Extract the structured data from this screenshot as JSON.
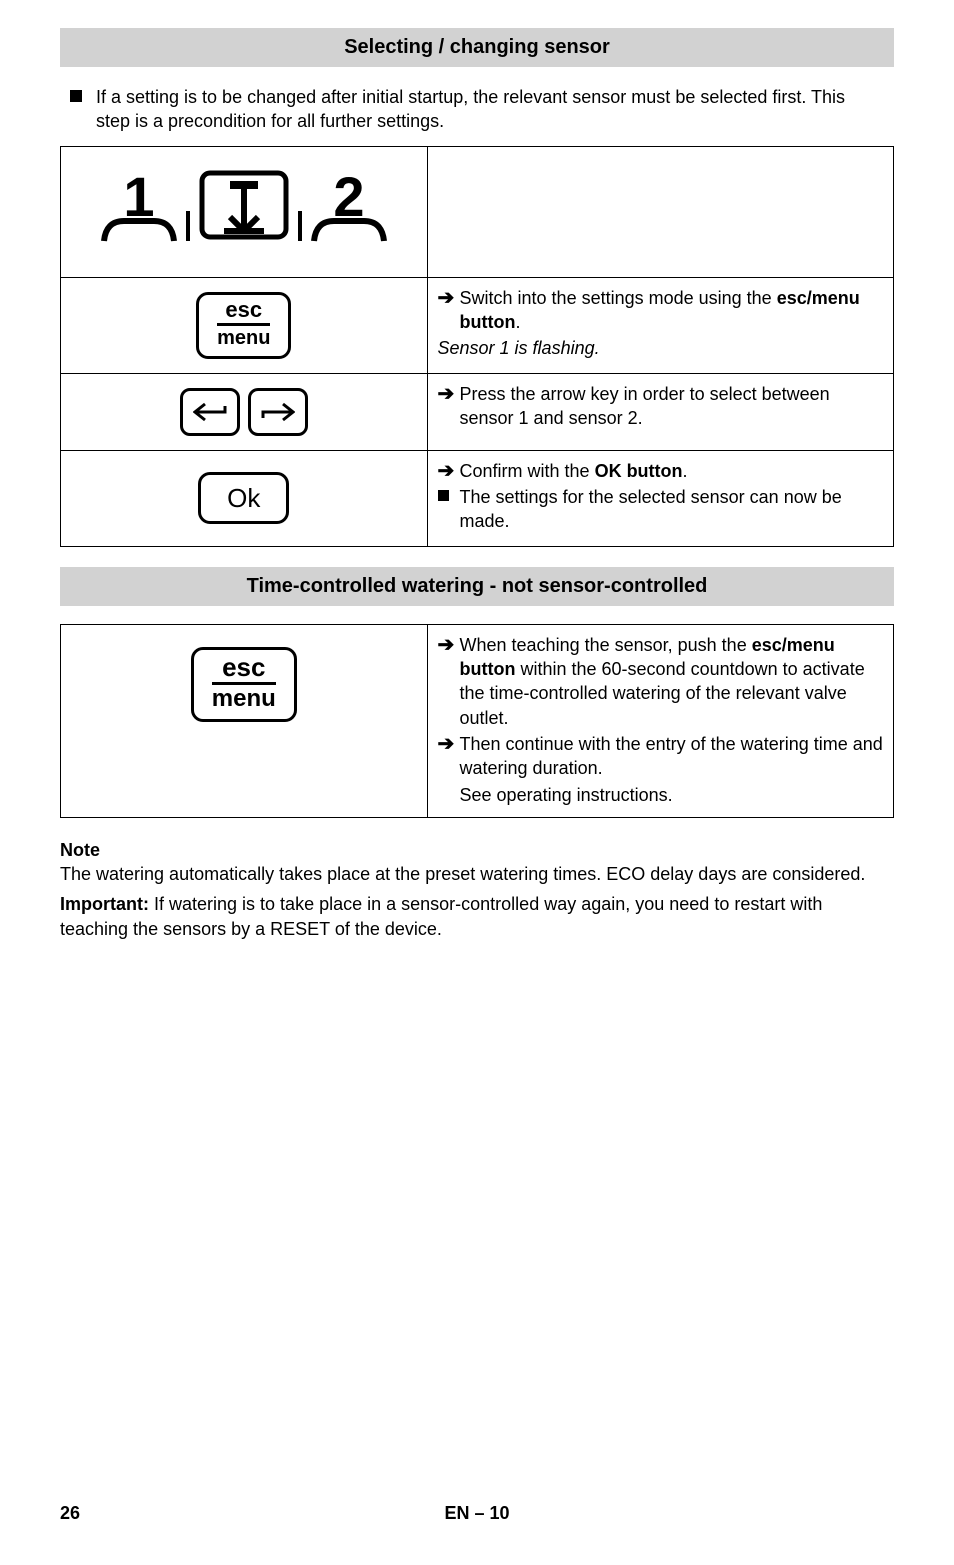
{
  "section1": {
    "title": "Selecting / changing sensor",
    "intro": "If a setting is to be changed after initial startup, the relevant sensor must be selected first. This step is a precondition for all further settings.",
    "key1_top": "esc",
    "key1_bot": "menu",
    "ok_label": "Ok",
    "row2_a": "Switch into the settings mode using the ",
    "row2_b": "esc/menu button",
    "row2_c": ".",
    "row2_italic": "Sensor 1 is flashing.",
    "row3": "Press the arrow key in order to select between sensor 1 and sensor 2.",
    "row4_a": "Confirm with the ",
    "row4_b": "OK button",
    "row4_c": ".",
    "row4_sq": "The settings for the selected sensor can now be made."
  },
  "section2": {
    "title": "Time-controlled watering - not sensor-controlled",
    "key_top": "esc",
    "key_bot": "menu",
    "l1_a": "When teaching the sensor, push the ",
    "l1_b": "esc/menu button",
    "l1_c": " within the 60-second countdown to activate the time-controlled watering of the relevant valve outlet.",
    "l2": "Then continue with the entry of the watering time and watering duration.",
    "l3": "See operating instructions."
  },
  "note": {
    "head": "Note",
    "body": "The watering automatically takes place at the preset watering times. ECO delay days are considered.",
    "imp_label": "Important:",
    "imp_text": " If watering is to take place in a sensor-controlled way again, you need to restart with teaching the sensors by a RESET of the device."
  },
  "footer": {
    "page": "26",
    "mid": "EN – 10"
  }
}
